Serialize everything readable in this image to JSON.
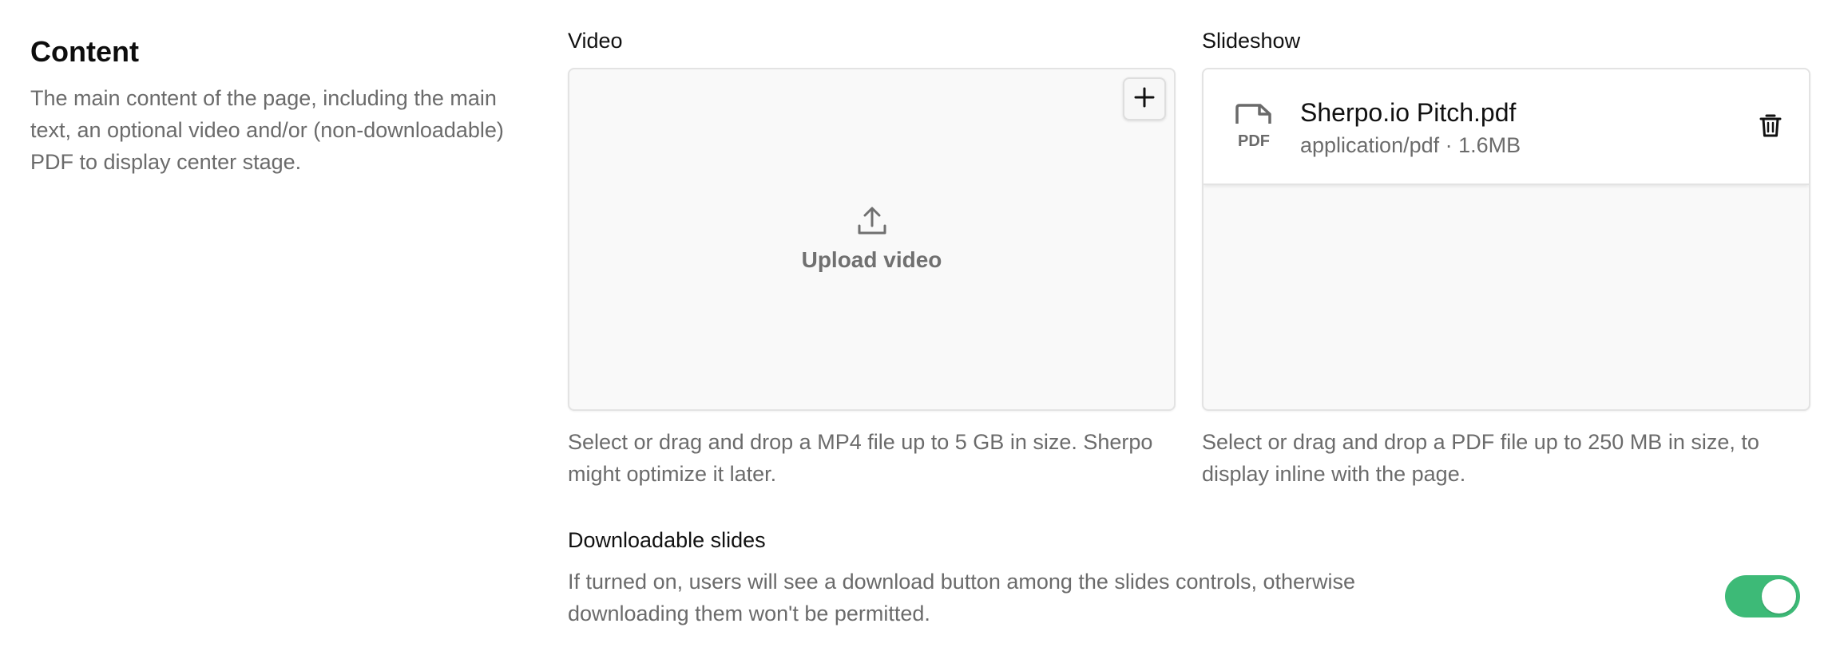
{
  "section": {
    "title": "Content",
    "description": "The main content of the page, including the main text, an optional video and/or (non-downloadable) PDF to display center stage."
  },
  "video": {
    "label": "Video",
    "upload_label": "Upload video",
    "help": "Select or drag and drop a MP4 file up to 5 GB in size. Sherpo might optimize it later.",
    "icons": {
      "add": "plus-icon",
      "upload": "upload-icon"
    }
  },
  "slideshow": {
    "label": "Slideshow",
    "file": {
      "name": "Sherpo.io Pitch.pdf",
      "meta": "application/pdf · 1.6MB",
      "icon_text": "PDF"
    },
    "help": "Select or drag and drop a PDF file up to 250 MB in size, to display inline with the page.",
    "icons": {
      "file": "pdf-file-icon",
      "delete": "trash-icon"
    }
  },
  "downloadable": {
    "label": "Downloadable slides",
    "help": "If turned on, users will see a download button among the slides controls, otherwise downloading them won't be permitted.",
    "enabled": true
  },
  "colors": {
    "toggle_on": "#3dba77",
    "muted_text": "#6b6b6b",
    "panel_bg": "#f9f9f9"
  }
}
